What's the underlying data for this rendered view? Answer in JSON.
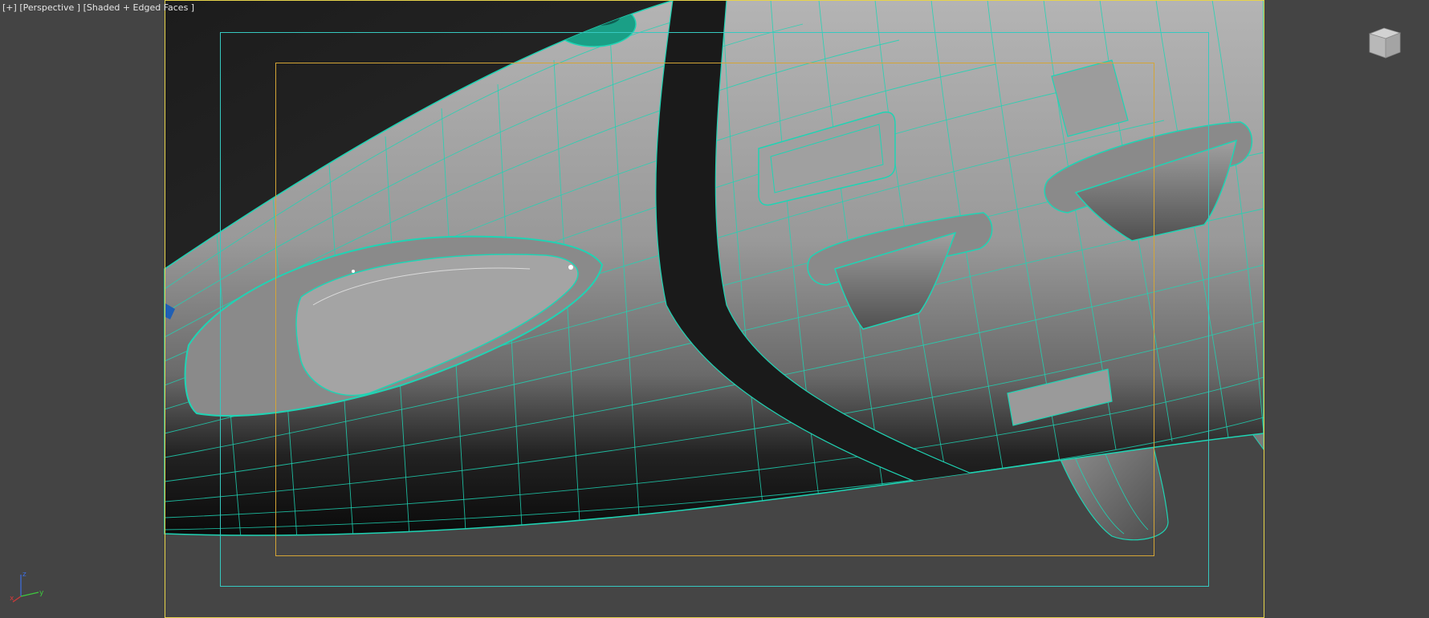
{
  "viewport": {
    "menu_plus": "[+]",
    "view_name": "[Perspective ]",
    "shading_mode": "[Shaded + Edged Faces ]"
  },
  "axis_tripod": {
    "x": "x",
    "y": "y",
    "z": "z"
  },
  "viewcube": {
    "icon": "viewcube-icon"
  },
  "colors": {
    "viewport_bg": "#444444",
    "safe_frame_outer": "#e6d34a",
    "safe_frame_action": "#36c9c0",
    "safe_frame_title": "#d4a536",
    "wire": "#1fd4b4",
    "mesh_light": "#a8a8a8",
    "mesh_dark": "#0e0e0e"
  }
}
